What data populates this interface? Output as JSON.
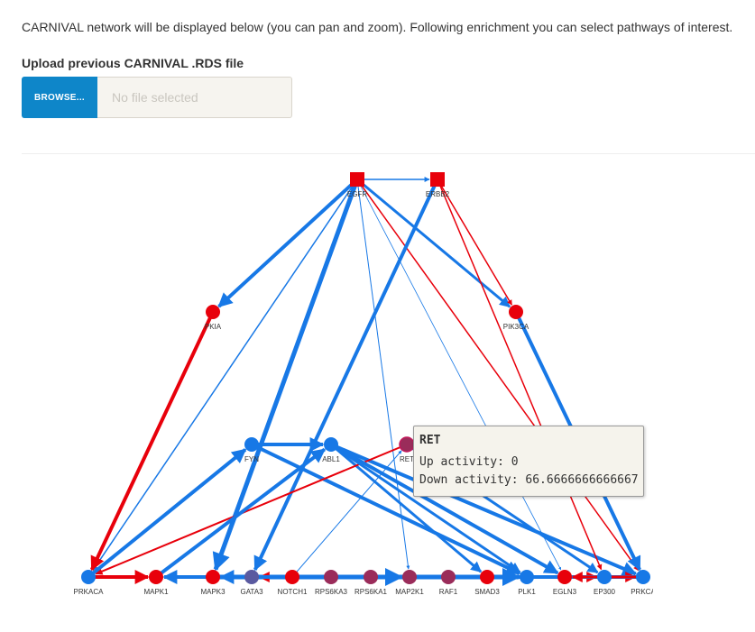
{
  "intro_text": "CARNIVAL network will be displayed below (you can pan and zoom). Following enrichment you can select pathways of interest.",
  "upload": {
    "label": "Upload previous CARNIVAL .RDS file",
    "browse_label": "BROWSE...",
    "placeholder": "No file selected"
  },
  "colors": {
    "up": "#e8000b",
    "down": "#1778e6",
    "mixed": "#9a2c5a",
    "mixed_blue": "#5a5aa0"
  },
  "network": {
    "nodes": [
      {
        "id": "EGFR",
        "label": "EGFR",
        "shape": "square",
        "state": "up"
      },
      {
        "id": "ERBB2",
        "label": "ERBB2",
        "shape": "square",
        "state": "up"
      },
      {
        "id": "PKIA",
        "label": "PKIA",
        "shape": "circle",
        "state": "up"
      },
      {
        "id": "PIK3CA",
        "label": "PIK3CA",
        "shape": "circle",
        "state": "up"
      },
      {
        "id": "FYN",
        "label": "FYN",
        "shape": "circle",
        "state": "down"
      },
      {
        "id": "ABL1",
        "label": "ABL1",
        "shape": "circle",
        "state": "down"
      },
      {
        "id": "RET",
        "label": "RET",
        "shape": "circle",
        "state": "mixed"
      },
      {
        "id": "PRKACA",
        "label": "PRKACA",
        "shape": "circle",
        "state": "down"
      },
      {
        "id": "MAPK1",
        "label": "MAPK1",
        "shape": "circle",
        "state": "up"
      },
      {
        "id": "MAPK3",
        "label": "MAPK3",
        "shape": "circle",
        "state": "up"
      },
      {
        "id": "GATA3",
        "label": "GATA3",
        "shape": "circle",
        "state": "mixed_blue"
      },
      {
        "id": "NOTCH1",
        "label": "NOTCH1",
        "shape": "circle",
        "state": "up"
      },
      {
        "id": "RPS6KA3",
        "label": "RPS6KA3",
        "shape": "circle",
        "state": "mixed"
      },
      {
        "id": "RPS6KA1",
        "label": "RPS6KA1",
        "shape": "circle",
        "state": "mixed"
      },
      {
        "id": "MAP2K1",
        "label": "MAP2K1",
        "shape": "circle",
        "state": "mixed"
      },
      {
        "id": "RAF1",
        "label": "RAF1",
        "shape": "circle",
        "state": "mixed"
      },
      {
        "id": "SMAD3",
        "label": "SMAD3",
        "shape": "circle",
        "state": "up"
      },
      {
        "id": "PLK1",
        "label": "PLK1",
        "shape": "circle",
        "state": "down"
      },
      {
        "id": "EGLN3",
        "label": "EGLN3",
        "shape": "circle",
        "state": "up"
      },
      {
        "id": "EP300",
        "label": "EP300",
        "shape": "circle",
        "state": "down"
      },
      {
        "id": "PRKCA",
        "label": "PRKCA",
        "shape": "circle",
        "state": "down"
      }
    ],
    "edges": [
      {
        "from": "EGFR",
        "to": "ERBB2",
        "sign": "down",
        "weight": 1.5
      },
      {
        "from": "EGFR",
        "to": "PKIA",
        "sign": "down",
        "weight": 4
      },
      {
        "from": "EGFR",
        "to": "PIK3CA",
        "sign": "down",
        "weight": 3
      },
      {
        "from": "EGFR",
        "to": "MAPK3",
        "sign": "down",
        "weight": 5
      },
      {
        "from": "EGFR",
        "to": "MAP2K1",
        "sign": "down",
        "weight": 1
      },
      {
        "from": "EGFR",
        "to": "EGLN3",
        "sign": "down",
        "weight": 0.8
      },
      {
        "from": "EGFR",
        "to": "PRKCA",
        "sign": "up",
        "weight": 1.5
      },
      {
        "from": "EGFR",
        "to": "PRKACA",
        "sign": "down",
        "weight": 1.5
      },
      {
        "from": "ERBB2",
        "to": "PIK3CA",
        "sign": "up",
        "weight": 1.5
      },
      {
        "from": "ERBB2",
        "to": "GATA3",
        "sign": "down",
        "weight": 4
      },
      {
        "from": "PKIA",
        "to": "PRKACA",
        "sign": "up",
        "weight": 4
      },
      {
        "from": "PIK3CA",
        "to": "PRKCA",
        "sign": "down",
        "weight": 4
      },
      {
        "from": "FYN",
        "to": "ABL1",
        "sign": "down",
        "weight": 4
      },
      {
        "from": "FYN",
        "to": "PLK1",
        "sign": "down",
        "weight": 4
      },
      {
        "from": "ABL1",
        "to": "PRKCA",
        "sign": "down",
        "weight": 4
      },
      {
        "from": "ABL1",
        "to": "SMAD3",
        "sign": "down",
        "weight": 3
      },
      {
        "from": "RET",
        "to": "PRKACA",
        "sign": "up",
        "weight": 2
      },
      {
        "from": "RET",
        "to": "EP300",
        "sign": "down",
        "weight": 3
      },
      {
        "from": "PRKACA",
        "to": "FYN",
        "sign": "down",
        "weight": 4
      },
      {
        "from": "PRKACA",
        "to": "MAPK1",
        "sign": "up",
        "weight": 4
      },
      {
        "from": "MAPK1",
        "to": "ABL1",
        "sign": "down",
        "weight": 4
      },
      {
        "from": "MAPK3",
        "to": "MAP2K1",
        "sign": "down",
        "weight": 5
      },
      {
        "from": "GATA3",
        "to": "PLK1",
        "sign": "down",
        "weight": 5
      },
      {
        "from": "NOTCH1",
        "to": "RET",
        "sign": "down",
        "weight": 1
      },
      {
        "from": "SMAD3",
        "to": "PRKCA",
        "sign": "up",
        "weight": 3
      },
      {
        "from": "EGLN3",
        "to": "EP300",
        "sign": "up",
        "weight": 3
      },
      {
        "from": "EP300",
        "to": "MAPK3",
        "sign": "down",
        "weight": 4
      },
      {
        "from": "RPS6KA3",
        "to": "MAPK1",
        "sign": "down",
        "weight": 3
      },
      {
        "from": "RAF1",
        "to": "MAPK3",
        "sign": "down",
        "weight": 3
      },
      {
        "from": "PLK1",
        "to": "GATA3",
        "sign": "up",
        "weight": 3
      },
      {
        "from": "PRKCA",
        "to": "MAPK1",
        "sign": "down",
        "weight": 4
      },
      {
        "from": "PRKCA",
        "to": "EGLN3",
        "sign": "up",
        "weight": 3
      },
      {
        "from": "ABL1",
        "to": "EGLN3",
        "sign": "down",
        "weight": 4
      },
      {
        "from": "ABL1",
        "to": "PLK1",
        "sign": "down",
        "weight": 3
      },
      {
        "from": "ERBB2",
        "to": "EP300",
        "sign": "up",
        "weight": 1.5
      }
    ]
  },
  "tooltip": {
    "title": "RET",
    "up_line": "Up activity: 0",
    "down_line": "Down activity: 66.6666666666667"
  }
}
